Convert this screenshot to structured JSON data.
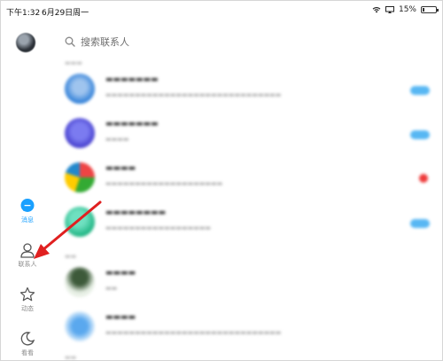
{
  "status_bar": {
    "time": "下午1:32",
    "date": "6月29日周一",
    "battery": "15%",
    "battery_level": 0.15
  },
  "sidebar": {
    "items": [
      {
        "label": "消息",
        "icon": "chat-bubble-icon",
        "active": true
      },
      {
        "label": "联系人",
        "icon": "person-icon",
        "active": false
      },
      {
        "label": "动态",
        "icon": "star-icon",
        "active": false
      },
      {
        "label": "看看",
        "icon": "moon-icon",
        "active": false
      }
    ]
  },
  "search": {
    "placeholder": "搜索联系人"
  },
  "colors": {
    "accent": "#1aa0ff",
    "annotation_arrow": "#e02020",
    "unread_badge": "#57b7f3",
    "alert_dot": "#ee3b3b"
  },
  "annotation": {
    "arrow_target": "联系人"
  }
}
